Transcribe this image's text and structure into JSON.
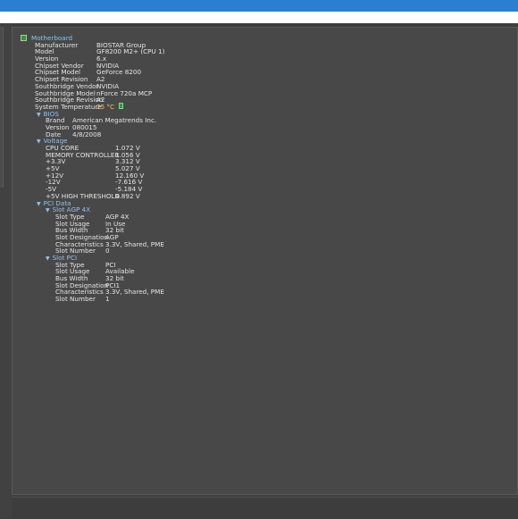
{
  "tree": {
    "root_label": "Motherboard",
    "root_icon": "motherboard-icon",
    "motherboard": [
      {
        "label": "Manufacturer",
        "value": "BIOSTAR Group"
      },
      {
        "label": "Model",
        "value": "GF8200 M2+ (CPU 1)"
      },
      {
        "label": "Version",
        "value": "6.x"
      },
      {
        "label": "Chipset Vendor",
        "value": "NVIDIA"
      },
      {
        "label": "Chipset Model",
        "value": "GeForce 8200"
      },
      {
        "label": "Chipset Revision",
        "value": "A2"
      },
      {
        "label": "Southbridge Vendor",
        "value": "NVIDIA"
      },
      {
        "label": "Southbridge Model",
        "value": "nForce 720a MCP"
      },
      {
        "label": "Southbridge Revision",
        "value": "A2"
      },
      {
        "label": "System Temperature",
        "value": "25 °C"
      }
    ],
    "bios": {
      "label": "BIOS",
      "rows": [
        {
          "label": "Brand",
          "value": "American Megatrends Inc."
        },
        {
          "label": "Version",
          "value": "080015"
        },
        {
          "label": "Date",
          "value": "4/8/2008"
        }
      ]
    },
    "voltage": {
      "label": "Voltage",
      "rows": [
        {
          "label": "CPU CORE",
          "value": "1.072 V"
        },
        {
          "label": "MEMORY CONTROLLER",
          "value": "1.056 V"
        },
        {
          "label": "+3.3V",
          "value": "3.312 V"
        },
        {
          "label": "+5V",
          "value": "5.027 V"
        },
        {
          "label": "+12V",
          "value": "12.160 V"
        },
        {
          "label": "-12V",
          "value": "-7.616 V"
        },
        {
          "label": "-5V",
          "value": "-5.184 V"
        },
        {
          "label": "+5V HIGH THRESHOLD",
          "value": "4.892 V"
        }
      ]
    },
    "pci": {
      "label": "PCI Data",
      "slots": [
        {
          "label": "Slot AGP 4X",
          "rows": [
            {
              "label": "Slot Type",
              "value": "AGP 4X"
            },
            {
              "label": "Slot Usage",
              "value": "In Use"
            },
            {
              "label": "Bus Width",
              "value": "32 bit"
            },
            {
              "label": "Slot Designation",
              "value": "AGP"
            },
            {
              "label": "Characteristics",
              "value": "3.3V, Shared, PME"
            },
            {
              "label": "Slot Number",
              "value": "0"
            }
          ]
        },
        {
          "label": "Slot PCI",
          "rows": [
            {
              "label": "Slot Type",
              "value": "PCI"
            },
            {
              "label": "Slot Usage",
              "value": "Available"
            },
            {
              "label": "Bus Width",
              "value": "32 bit"
            },
            {
              "label": "Slot Designation",
              "value": "PCI1"
            },
            {
              "label": "Characteristics",
              "value": "3.3V, Shared, PME"
            },
            {
              "label": "Slot Number",
              "value": "1"
            }
          ]
        }
      ]
    }
  },
  "colors": {
    "titlebar": "#2b7fd0",
    "node_text": "#8fc3ee",
    "temperature": "#f2c94c"
  }
}
